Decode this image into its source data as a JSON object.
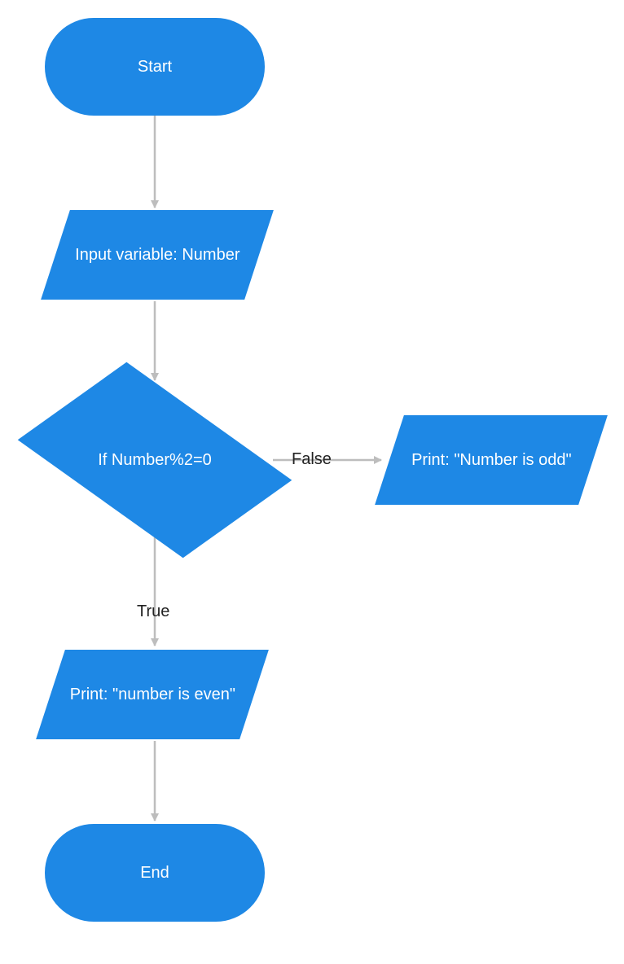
{
  "colors": {
    "fill": "#1e88e5",
    "connector": "#bdbdbd",
    "text_dark": "#222222"
  },
  "nodes": {
    "start": {
      "label": "Start"
    },
    "input": {
      "label": "Input variable: Number"
    },
    "decision": {
      "label": "If Number%2=0"
    },
    "print_odd": {
      "label": "Print: \"Number is odd\""
    },
    "print_even": {
      "label": "Print: \"number is even\""
    },
    "end": {
      "label": "End"
    }
  },
  "edges": {
    "true_label": "True",
    "false_label": "False"
  }
}
